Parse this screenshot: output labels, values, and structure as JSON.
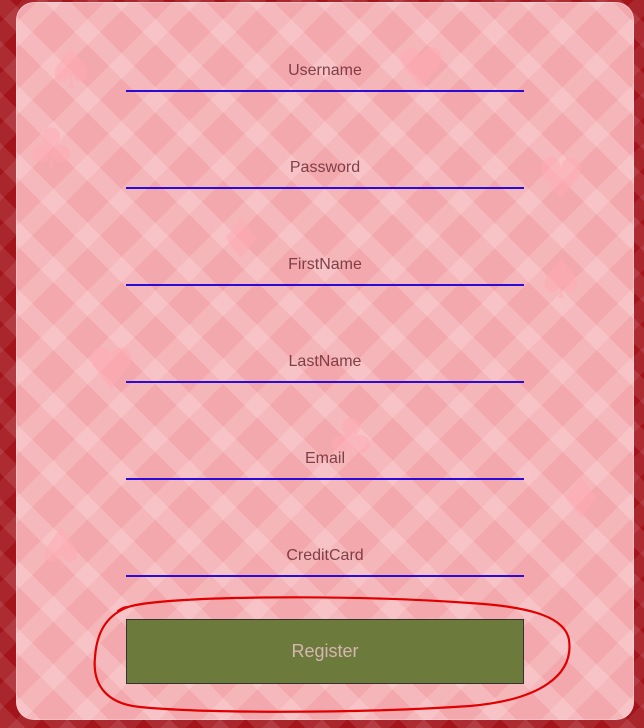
{
  "form": {
    "fields": [
      {
        "name": "username-input",
        "placeholder": "Username"
      },
      {
        "name": "password-input",
        "placeholder": "Password"
      },
      {
        "name": "firstname-input",
        "placeholder": "FirstName"
      },
      {
        "name": "lastname-input",
        "placeholder": "LastName"
      },
      {
        "name": "email-input",
        "placeholder": "Email"
      },
      {
        "name": "creditcard-input",
        "placeholder": "CreditCard"
      }
    ],
    "register_label": "Register"
  },
  "theme": {
    "page_background": "#a3141b",
    "card_background": "#f3a8ad",
    "input_underline": "#2b0cd6",
    "button_background": "#6c7a3b",
    "annotation_color": "#e00000"
  },
  "decor_suits": [
    "♠",
    "♥",
    "♣",
    "♦"
  ]
}
